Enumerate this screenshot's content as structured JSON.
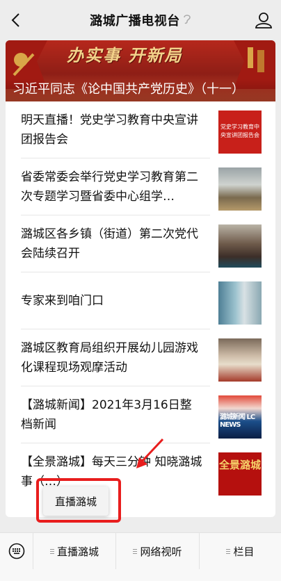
{
  "header": {
    "title": "潞城广播电视台",
    "ear_icon": "ear-icon",
    "back_icon": "chevron-left-icon",
    "user_icon": "user-icon"
  },
  "banner": {
    "slogan": "办实事 开新局",
    "caption": "习近平同志《论中国共产党历史》（十一）"
  },
  "articles": [
    {
      "title": "明天直播！党史学习教育中央宣讲团报告会",
      "thumb_text": "党史学习教育中央宣讲团报告会"
    },
    {
      "title": "省委常委会举行党史学习教育第二次专题学习暨省委中心组学…"
    },
    {
      "title": "潞城区各乡镇（街道）第二次党代会陆续召开"
    },
    {
      "title": "专家来到咱门口"
    },
    {
      "title": "潞城区教育局组织开展幼儿园游戏化课程现场观摩活动"
    },
    {
      "title": "【潞城新闻】2021年3月16日整档新闻",
      "thumb_text": "潞城新闻 LC NEWS"
    },
    {
      "title": "【全景潞城】每天三分钟 知晓潞城事（…）",
      "thumb_text": "全景潞城"
    }
  ],
  "popup": {
    "label": "直播潞城"
  },
  "tabbar": {
    "keyboard_icon": "keyboard-icon",
    "tabs": [
      "直播潞城",
      "网络视听",
      "栏目"
    ]
  },
  "colors": {
    "accent_red": "#e81d1d",
    "banner_red": "#b6281c"
  }
}
